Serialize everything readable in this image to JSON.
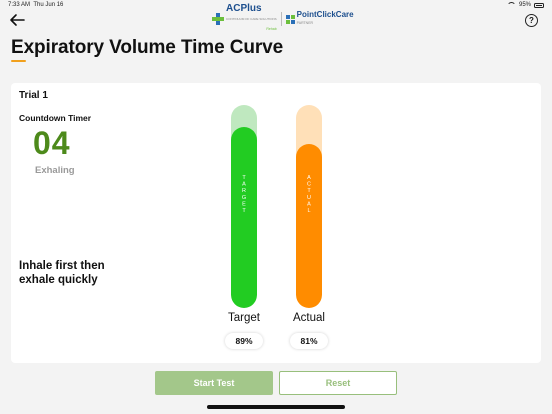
{
  "status_bar": {
    "time": "7:33 AM",
    "date": "Thu Jun 16",
    "battery": "95%"
  },
  "header": {
    "acp_name": "ACPlus",
    "acp_subtitle": "CONTINUUM OF CARE SOLUTIONS",
    "acp_tag": "Rehab",
    "pcc_name": "PointClickCare",
    "pcc_subtitle": "PARTNER"
  },
  "page": {
    "title": "Expiratory Volume Time Curve"
  },
  "trial": {
    "label": "Trial 1",
    "countdown_label": "Countdown Timer",
    "countdown_value": "04",
    "phase": "Exhaling",
    "instruction": "Inhale first then exhale quickly"
  },
  "gauges": {
    "target": {
      "name": "Target",
      "vertical_label": "TARGET",
      "percent": "89%",
      "level": 0.89,
      "fill_color": "#22cc22",
      "bg_color": "#bfe8bf"
    },
    "actual": {
      "name": "Actual",
      "vertical_label": "ACTUAL",
      "percent": "81%",
      "level": 0.81,
      "fill_color": "#ff8c00",
      "bg_color": "#ffe0b8"
    }
  },
  "buttons": {
    "start": "Start Test",
    "reset": "Reset"
  },
  "accent_color": "#f1a01d"
}
